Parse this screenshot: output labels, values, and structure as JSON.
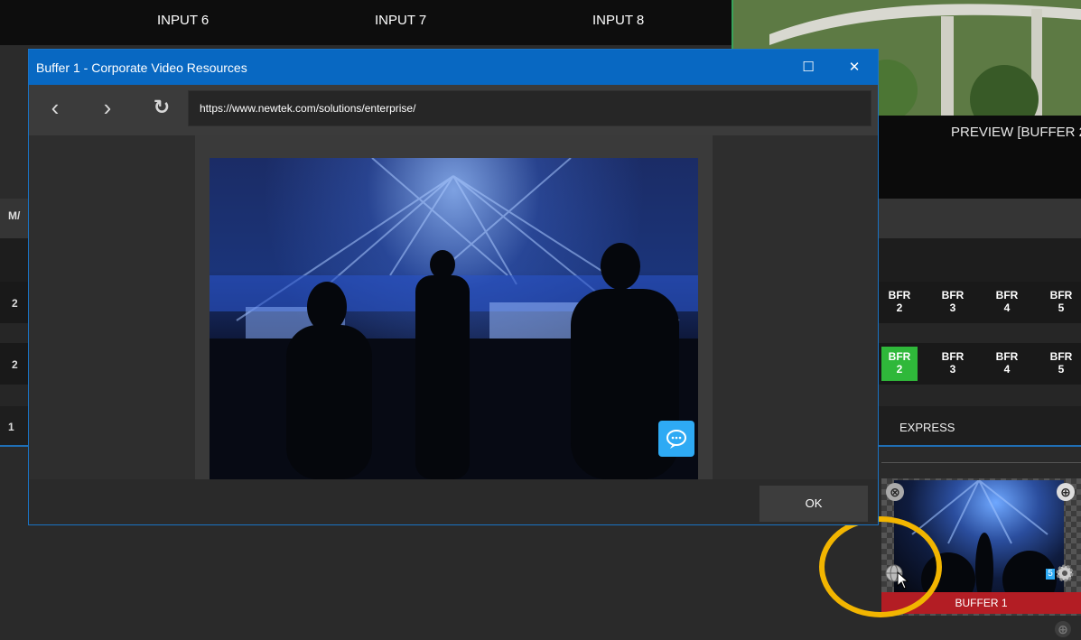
{
  "background": {
    "inputs": [
      "INPUT 6",
      "INPUT 7",
      "INPUT 8"
    ],
    "preview_label": "PREVIEW [BUFFER 2",
    "left_labels": {
      "row1": "2",
      "row2": "2",
      "row3": "1",
      "mid": "M/"
    },
    "bfr_row1": [
      {
        "label": "BFR",
        "num": "2"
      },
      {
        "label": "BFR",
        "num": "3"
      },
      {
        "label": "BFR",
        "num": "4"
      },
      {
        "label": "BFR",
        "num": "5"
      }
    ],
    "bfr_row2": [
      {
        "label": "BFR",
        "num": "2",
        "active": true
      },
      {
        "label": "BFR",
        "num": "3"
      },
      {
        "label": "BFR",
        "num": "4"
      },
      {
        "label": "BFR",
        "num": "5"
      }
    ],
    "express_label": "EXPRESS",
    "buffer_tile": {
      "caption": "BUFFER 1",
      "remove_symbol": "⊗",
      "add_symbol": "⊕",
      "badge": "5"
    },
    "colors": {
      "accent_blue": "#0868c2",
      "active_green": "#2fb83a",
      "caption_red": "#b31d24",
      "annotation_yellow": "#f2b500"
    }
  },
  "dialog": {
    "title": "Buffer 1 - Corporate Video Resources",
    "maximize_symbol": "☐",
    "close_symbol": "✕",
    "nav": {
      "back_symbol": "‹",
      "forward_symbol": "›",
      "reload_symbol": "↻"
    },
    "url": "https://www.newtek.com/solutions/enterprise/",
    "ok_label": "OK"
  }
}
